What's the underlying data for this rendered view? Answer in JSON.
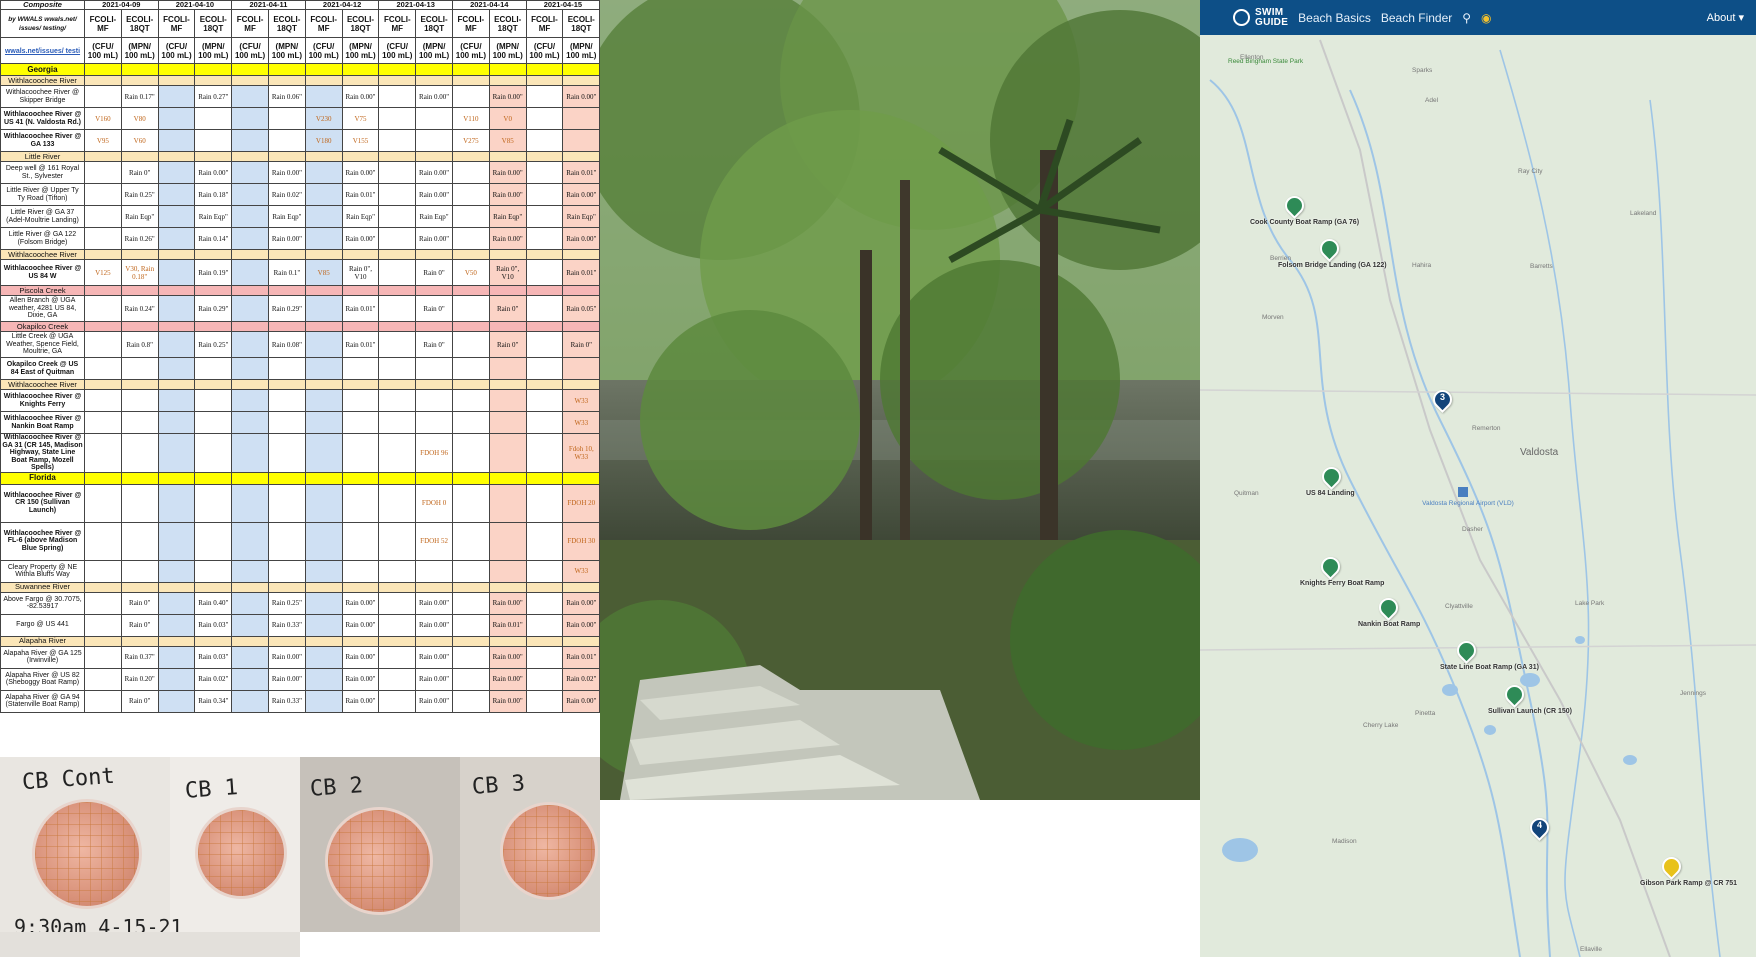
{
  "sheet": {
    "header": {
      "composite": "Composite",
      "by": "by WWALS wwals.net/ issues/ testing/",
      "dates": [
        "2021-04-09",
        "2021-04-10",
        "2021-04-11",
        "2021-04-12",
        "2021-04-13",
        "2021-04-14",
        "2021-04-15"
      ],
      "col_types": [
        "FCOLI-MF",
        "ECOLI-18QT"
      ],
      "units": [
        "(CFU/ 100 mL)",
        "(MPN/ 100 mL)"
      ],
      "link": "wwals.net/issues/ testi"
    },
    "rows": [
      {
        "kind": "region",
        "label": "Georgia"
      },
      {
        "kind": "river",
        "label": "Withlacoochee River"
      },
      {
        "kind": "site",
        "label": "Withlacoochee River @ Skipper Bridge",
        "cells": [
          "",
          "Rain 0.17\"",
          "",
          "Rain 0.27\"",
          "",
          "Rain 0.06\"",
          "",
          "Rain 0.00\"",
          "",
          "Rain 0.00\"",
          "",
          "Rain 0.00\"",
          "",
          "Rain 0.00\""
        ]
      },
      {
        "kind": "site",
        "bold": true,
        "label": "Withlacoochee River @ US 41 (N. Valdosta Rd.)",
        "cells": [
          "V160",
          "V80",
          "",
          "",
          "",
          "",
          "V230",
          "V75",
          "",
          "",
          "V110",
          "V0",
          "",
          ""
        ]
      },
      {
        "kind": "site",
        "bold": true,
        "label": "Withlacoochee River @ GA 133",
        "cells": [
          "V95",
          "V60",
          "",
          "",
          "",
          "",
          "V180",
          "V155",
          "",
          "",
          "V275",
          "V85",
          "",
          ""
        ]
      },
      {
        "kind": "river",
        "label": "Little River"
      },
      {
        "kind": "site",
        "label": "Deep well @ 161 Royal St., Sylvester",
        "cells": [
          "",
          "Rain 0\"",
          "",
          "Rain 0.00\"",
          "",
          "Rain 0.00\"",
          "",
          "Rain 0.00\"",
          "",
          "Rain 0.00\"",
          "",
          "Rain 0.00\"",
          "",
          "Rain 0.01\""
        ]
      },
      {
        "kind": "site",
        "label": "Little River @ Upper Ty Ty Road (Tifton)",
        "cells": [
          "",
          "Rain 0.25\"",
          "",
          "Rain 0.18\"",
          "",
          "Rain 0.02\"",
          "",
          "Rain 0.01\"",
          "",
          "Rain 0.00\"",
          "",
          "Rain 0.00\"",
          "",
          "Rain 0.00\""
        ]
      },
      {
        "kind": "site",
        "label": "Little River @ GA 37 (Adel-Moultrie Landing)",
        "cells": [
          "",
          "Rain Eqp\"",
          "",
          "Rain Eqp\"",
          "",
          "Rain Eqp\"",
          "",
          "Rain Eqp\"",
          "",
          "Rain Eqp\"",
          "",
          "Rain Eqp\"",
          "",
          "Rain Eqp\""
        ]
      },
      {
        "kind": "site",
        "label": "Little River @ GA 122 (Folsom Bridge)",
        "cells": [
          "",
          "Rain 0.26\"",
          "",
          "Rain 0.14\"",
          "",
          "Rain 0.00\"",
          "",
          "Rain 0.00\"",
          "",
          "Rain 0.00\"",
          "",
          "Rain 0.00\"",
          "",
          "Rain 0.00\""
        ]
      },
      {
        "kind": "river",
        "label": "Withlacoochee River"
      },
      {
        "kind": "site",
        "bold": true,
        "tall": true,
        "label": "Withlacoochee River @ US 84 W",
        "cells": [
          "V125",
          "V30, Rain 0.18\"",
          "",
          "Rain 0.19\"",
          "",
          "Rain 0.1\"",
          "V85",
          "Rain 0\", V10",
          "",
          "Rain 0\"",
          "V50",
          "Rain 0\", V10",
          "",
          "Rain 0.01\""
        ]
      },
      {
        "kind": "river",
        "pink": true,
        "label": "Piscola Creek"
      },
      {
        "kind": "site",
        "tall": true,
        "label": "Allen Branch @ UGA weather, 4281 US 84, Dixie, GA",
        "cells": [
          "",
          "Rain 0.24\"",
          "",
          "Rain 0.29\"",
          "",
          "Rain 0.29\"",
          "",
          "Rain 0.01\"",
          "",
          "Rain 0\"",
          "",
          "Rain 0\"",
          "",
          "Rain 0.05\""
        ]
      },
      {
        "kind": "river",
        "pink": true,
        "label": "Okapilco Creek"
      },
      {
        "kind": "site",
        "tall": true,
        "label": "Little Creek @ UGA Weather, Spence Field, Moultrie, GA",
        "cells": [
          "",
          "Rain 0.8\"",
          "",
          "Rain 0.25\"",
          "",
          "Rain 0.08\"",
          "",
          "Rain 0.01\"",
          "",
          "Rain 0\"",
          "",
          "Rain 0\"",
          "",
          "Rain 0\""
        ]
      },
      {
        "kind": "site",
        "bold": true,
        "label": "Okapilco Creek @ US 84 East of Quitman",
        "cells": [
          "",
          "",
          "",
          "",
          "",
          "",
          "",
          "",
          "",
          "",
          "",
          "",
          "",
          ""
        ]
      },
      {
        "kind": "river",
        "label": "Withlacoochee River"
      },
      {
        "kind": "site",
        "bold": true,
        "label": "Withlacoochee River @ Knights Ferry",
        "cells": [
          "",
          "",
          "",
          "",
          "",
          "",
          "",
          "",
          "",
          "",
          "",
          "",
          "",
          "W33"
        ]
      },
      {
        "kind": "site",
        "bold": true,
        "label": "Withlacoochee River @ Nankin Boat Ramp",
        "cells": [
          "",
          "",
          "",
          "",
          "",
          "",
          "",
          "",
          "",
          "",
          "",
          "",
          "",
          "W33"
        ]
      },
      {
        "kind": "site",
        "bold": true,
        "xtall": true,
        "label": "Withlacoochee River @ GA 31 (CR 145, Madison Highway, State Line Boat Ramp, Mozell Spells)",
        "cells": [
          "",
          "",
          "",
          "",
          "",
          "",
          "",
          "",
          "",
          "FDOH 96",
          "",
          "",
          "",
          "Fdoh 10, W33"
        ]
      },
      {
        "kind": "region",
        "label": "Florida"
      },
      {
        "kind": "site",
        "bold": true,
        "xtall": true,
        "label": "Withlacoochee River @ CR 150 (Sullivan Launch)",
        "cells": [
          "",
          "",
          "",
          "",
          "",
          "",
          "",
          "",
          "",
          "FDOH 0",
          "",
          "",
          "",
          "FDOH 20"
        ]
      },
      {
        "kind": "site",
        "bold": true,
        "xtall": true,
        "label": "Withlacoochee River @ FL-6 (above Madison Blue Spring)",
        "cells": [
          "",
          "",
          "",
          "",
          "",
          "",
          "",
          "",
          "",
          "FDOH 52",
          "",
          "",
          "",
          "FDOH 30"
        ]
      },
      {
        "kind": "site",
        "label": "Cleary Property @ NE Withla Bluffs Way",
        "cells": [
          "",
          "",
          "",
          "",
          "",
          "",
          "",
          "",
          "",
          "",
          "",
          "",
          "",
          "W33"
        ]
      },
      {
        "kind": "river",
        "label": "Suwannee River"
      },
      {
        "kind": "site",
        "label": "Above Fargo @ 30.7075, -82.53917",
        "cells": [
          "",
          "Rain 0\"",
          "",
          "Rain 0.40\"",
          "",
          "Rain 0.25\"",
          "",
          "Rain 0.00\"",
          "",
          "Rain 0.00\"",
          "",
          "Rain 0.00\"",
          "",
          "Rain 0.00\""
        ]
      },
      {
        "kind": "site",
        "label": "Fargo @ US 441",
        "cells": [
          "",
          "Rain 0\"",
          "",
          "Rain 0.03\"",
          "",
          "Rain 0.33\"",
          "",
          "Rain 0.00\"",
          "",
          "Rain 0.00\"",
          "",
          "Rain 0.01\"",
          "",
          "Rain 0.00\""
        ]
      },
      {
        "kind": "river",
        "label": "Alapaha River"
      },
      {
        "kind": "site",
        "label": "Alapaha River @ GA 125 (Irwinville)",
        "cells": [
          "",
          "Rain 0.37\"",
          "",
          "Rain 0.03\"",
          "",
          "Rain 0.00\"",
          "",
          "Rain 0.00\"",
          "",
          "Rain 0.00\"",
          "",
          "Rain 0.00\"",
          "",
          "Rain 0.01\""
        ]
      },
      {
        "kind": "site",
        "label": "Alapaha River @ US 82 (Sheboggy Boat Ramp)",
        "cells": [
          "",
          "Rain 0.20\"",
          "",
          "Rain 0.02\"",
          "",
          "Rain 0.00\"",
          "",
          "Rain 0.00\"",
          "",
          "Rain 0.00\"",
          "",
          "Rain 0.00\"",
          "",
          "Rain 0.02\""
        ]
      },
      {
        "kind": "site",
        "label": "Alapaha River @ GA 94 (Statenville Boat Ramp)",
        "cells": [
          "",
          "Rain 0\"",
          "",
          "Rain 0.34\"",
          "",
          "Rain 0.33\"",
          "",
          "Rain 0.00\"",
          "",
          "Rain 0.00\"",
          "",
          "Rain 0.00\"",
          "",
          "Rain 0.00\""
        ]
      }
    ]
  },
  "petri": {
    "labels": [
      "CB Cont",
      "CB 1",
      "CB 2",
      "CB 3"
    ],
    "timestamp": "9:30am 4-15-21"
  },
  "map": {
    "brand": [
      "SWIM",
      "GUIDE"
    ],
    "nav": [
      "Beach Basics",
      "Beach Finder"
    ],
    "about": "About",
    "icons": [
      "swim-guide-logo",
      "search-icon",
      "color-wheel-icon"
    ],
    "pins": [
      {
        "label": "Cook County Boat Ramp (GA 76)",
        "type": "green"
      },
      {
        "label": "Folsom Bridge Landing (GA 122)",
        "type": "green"
      },
      {
        "label": "3",
        "type": "navy"
      },
      {
        "label": "US 84 Landing",
        "type": "green"
      },
      {
        "label": "Knights Ferry Boat Ramp",
        "type": "green"
      },
      {
        "label": "Nankin Boat Ramp",
        "type": "green"
      },
      {
        "label": "State Line Boat Ramp (GA 31)",
        "type": "green"
      },
      {
        "label": "Sullivan Launch (CR 150)",
        "type": "green"
      },
      {
        "label": "4",
        "type": "navy"
      },
      {
        "label": "Gibson Park Ramp @ CR 751",
        "type": "gold"
      }
    ],
    "towns": [
      "Reed Bingham State Park",
      "Ellenton",
      "Sparks",
      "Adel",
      "Ray City",
      "Lakeland",
      "Berrien",
      "Hahira",
      "Barretts",
      "Morven",
      "Remerton",
      "Valdosta",
      "Valdosta Regional Airport (VLD)",
      "Quitman",
      "Dasher",
      "Clyattville",
      "Lake Park",
      "Pinetta",
      "Cherry Lake",
      "Madison",
      "Jennings",
      "Ellaville"
    ],
    "colors": {
      "nav": "#0d4f87",
      "green_pin": "#2e8b57",
      "navy_pin": "#12447a",
      "gold_pin": "#e8c21b"
    }
  }
}
